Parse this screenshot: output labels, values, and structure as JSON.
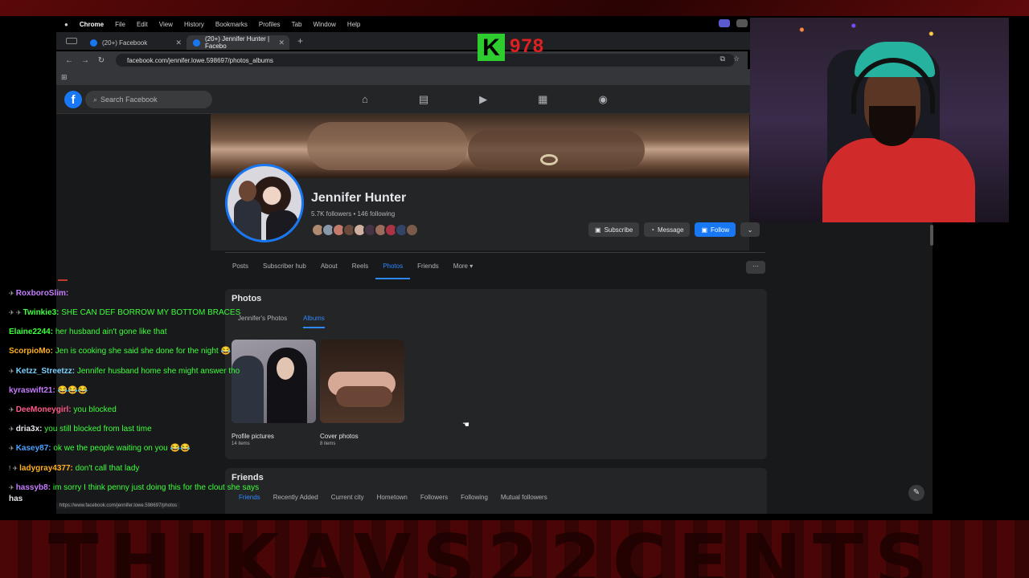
{
  "os_menu": {
    "app": "Chrome",
    "items": [
      "File",
      "Edit",
      "View",
      "History",
      "Bookmarks",
      "Profiles",
      "Tab",
      "Window",
      "Help"
    ]
  },
  "browser": {
    "tabs": [
      {
        "title": "(20+) Facebook"
      },
      {
        "title": "(20+) Jennifer Hunter | Facebo"
      }
    ],
    "url": "facebook.com/jennifer.lowe.598697/photos_albums",
    "status_url": "https://www.facebook.com/jennifer.lowe.598697/photos"
  },
  "facebook": {
    "search_placeholder": "Search Facebook",
    "logo": "f",
    "nav_icons": [
      "home-icon",
      "pages-icon",
      "video-icon",
      "marketplace-icon",
      "groups-icon"
    ]
  },
  "profile": {
    "name": "Jennifer Hunter",
    "stats": "5.7K followers • 146 following",
    "buttons": {
      "subscribe": "Subscribe",
      "message": "Message",
      "follow": "Follow",
      "dropdown": "⌄"
    },
    "friend_avatar_colors": [
      "#b08a70",
      "#8899aa",
      "#c47a6a",
      "#6a4a3a",
      "#d0b0a0",
      "#443344",
      "#9a6a5a",
      "#aa3344",
      "#334466",
      "#7a5a4a"
    ]
  },
  "profile_tabs": {
    "items": [
      "Posts",
      "Subscriber hub",
      "About",
      "Reels",
      "Photos",
      "Friends",
      "More ▾"
    ],
    "active": "Photos",
    "more_icon": "···"
  },
  "photos": {
    "title": "Photos",
    "subtabs": [
      "Jennifer's Photos",
      "Albums"
    ],
    "active": "Albums",
    "albums": [
      {
        "name": "Profile pictures",
        "count": "14 items"
      },
      {
        "name": "Cover photos",
        "count": "8 items"
      }
    ]
  },
  "friends": {
    "title": "Friends",
    "tabs": [
      "Friends",
      "Recently Added",
      "Current city",
      "Hometown",
      "Followers",
      "Following",
      "Mutual followers"
    ]
  },
  "overlay": {
    "logo_letter": "K",
    "logo_number": "978",
    "banner_text": "THIKAVS22CENTS"
  },
  "chat": [
    {
      "user": "RoxboroSlim:",
      "text": "",
      "color": "#c77dff",
      "badge": "✈"
    },
    {
      "user": "Twinkie3:",
      "text": "SHE CAN DEF BORROW MY BOTTOM BRACES",
      "color": "#3dff3d",
      "badge": "✈ ✈"
    },
    {
      "user": "Elaine2244:",
      "text": "her husband ain't gone like that",
      "color": "#3dff3d",
      "badge": ""
    },
    {
      "user": "ScorpioMo:",
      "text": "Jen is cooking she said she done for the night 😂",
      "color": "#ffb020",
      "badge": ""
    },
    {
      "user": "Ketzz_Streetzz:",
      "text": "Jennifer husband home she might answer tho",
      "color": "#7ad0ff",
      "badge": "✈"
    },
    {
      "user": "kyraswift21:",
      "text": "😂😂😂",
      "color": "#c77dff",
      "badge": ""
    },
    {
      "user": "DeeMoneygirl:",
      "text": "you blocked",
      "color": "#ff5a8a",
      "badge": "✈"
    },
    {
      "user": "dria3x:",
      "text": "you still blocked from last time",
      "color": "#e4e6eb",
      "badge": "✈"
    },
    {
      "user": "Kasey87:",
      "text": "ok we the people waiting on you 😂😂",
      "color": "#4aa3ff",
      "badge": "✈"
    },
    {
      "user": "ladygray4377:",
      "text": "don't call that lady",
      "color": "#ffb020",
      "badge": "! ✈"
    },
    {
      "user": "hassyb8:",
      "text": "im sorry I think penny just doing this for the clout she says",
      "color": "#c77dff",
      "badge": "✈"
    },
    {
      "user": "has",
      "text": "",
      "color": "#e4e6eb",
      "badge": ""
    }
  ]
}
